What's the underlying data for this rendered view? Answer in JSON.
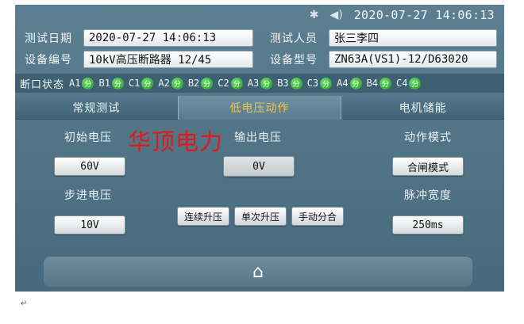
{
  "topbar": {
    "bluetooth_icon": "bluetooth-icon",
    "volume_icon": "speaker-icon",
    "datetime": "2020-07-27 14:06:13"
  },
  "info": {
    "test_date_label": "测试日期",
    "test_date_value": "2020-07-27 14:06:13",
    "tester_label": "测试人员",
    "tester_value": "张三李四",
    "device_no_label": "设备编号",
    "device_no_value": "10kV高压断路器 12/45",
    "device_model_label": "设备型号",
    "device_model_value": "ZN63A(VS1)-12/D63020"
  },
  "break_status": {
    "label": "断口状态",
    "channels": [
      {
        "name": "A1",
        "state": "分"
      },
      {
        "name": "B1",
        "state": "分"
      },
      {
        "name": "C1",
        "state": "分"
      },
      {
        "name": "A2",
        "state": "分"
      },
      {
        "name": "B2",
        "state": "分"
      },
      {
        "name": "C2",
        "state": "分"
      },
      {
        "name": "A3",
        "state": "分"
      },
      {
        "name": "B3",
        "state": "分"
      },
      {
        "name": "C3",
        "state": "分"
      },
      {
        "name": "A4",
        "state": "分"
      },
      {
        "name": "B4",
        "state": "分"
      },
      {
        "name": "C4",
        "state": "分"
      }
    ],
    "state_color": "#2fb33a"
  },
  "tabs": [
    "常规测试",
    "低电压动作",
    "电机储能"
  ],
  "active_tab_color": "#f3c44a",
  "panel": {
    "initial_voltage_label": "初始电压",
    "initial_voltage_value": "60V",
    "output_voltage_label": "输出电压",
    "output_voltage_value": "0V",
    "action_mode_label": "动作模式",
    "action_mode_value": "合闸模式",
    "step_voltage_label": "步进电压",
    "step_voltage_value": "10V",
    "pulse_width_label": "脉冲宽度",
    "pulse_width_value": "250ms",
    "btn_continuous": "连续升压",
    "btn_single": "单次升压",
    "btn_manual": "手动分合"
  },
  "brand_text": "华顶电力",
  "brand_color": "#e01818",
  "bottom": {
    "home_icon": "home-icon"
  },
  "footer_mark": "↵"
}
